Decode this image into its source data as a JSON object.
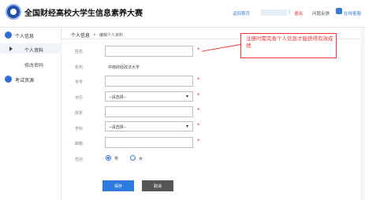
{
  "header": {
    "title": "全国财经高校大学生信息素养大赛",
    "home_link": "返回首页",
    "separator": "|",
    "logout": "退出",
    "help": "问题反馈",
    "service": "在线客服"
  },
  "sidebar": {
    "group_personal": "个人信息",
    "item_profile": "个人资料",
    "item_password": "修改密码",
    "group_exam": "考试资源"
  },
  "breadcrumb": {
    "section": "个人信息",
    "arrow": "▸",
    "page": "编辑个人资料"
  },
  "form": {
    "name_label": "姓名",
    "org_label": "机构",
    "org_value": "中南财经政法大学",
    "student_id_label": "学号",
    "degree_label": "学历",
    "degree_selected": "--请选择--",
    "college_label": "院系",
    "subject_label": "学科",
    "subject_selected": "--请选择--",
    "email_label": "邮箱",
    "gender_label": "性别",
    "gender_male": "男",
    "gender_female": "女",
    "required_mark": "*",
    "caret": "▾"
  },
  "buttons": {
    "save": "保存",
    "cancel": "取消"
  },
  "annotation": {
    "text": "注册时需完善个人信息才能获得有效成绩"
  }
}
